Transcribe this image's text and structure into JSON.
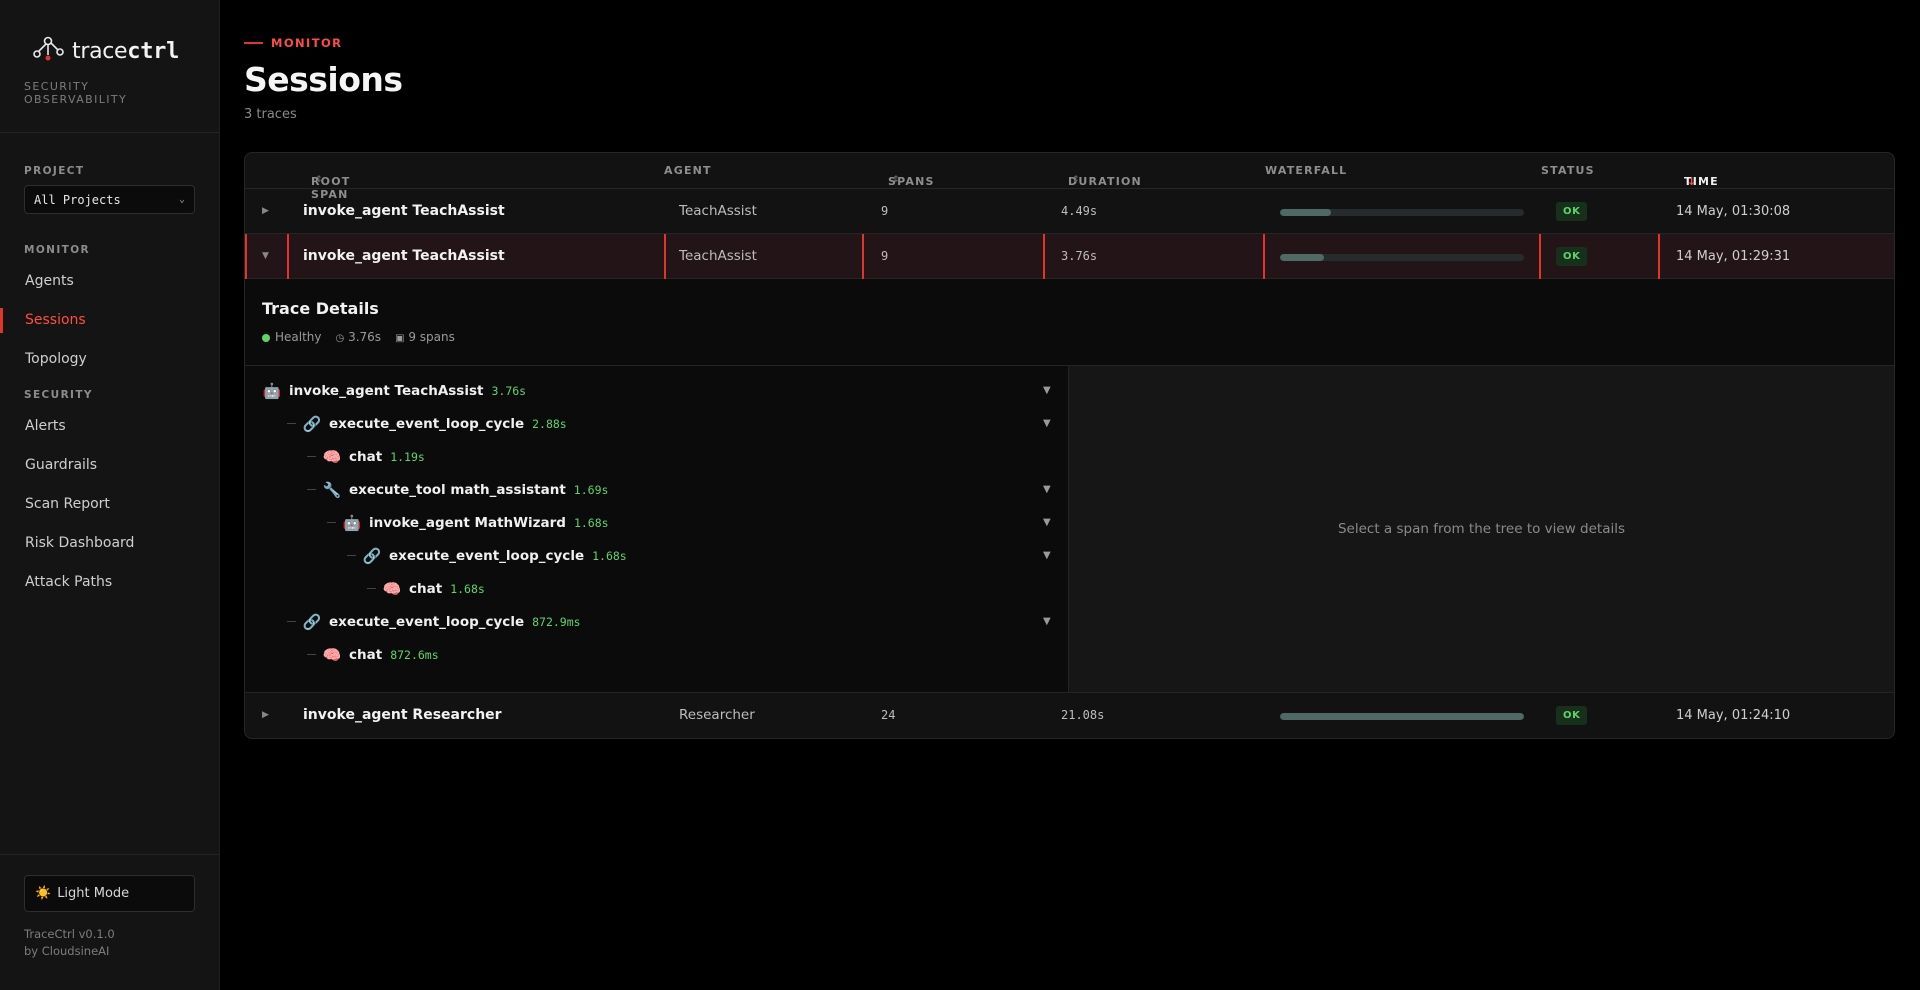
{
  "brand": {
    "logo_left": "trace",
    "logo_right": "ctrl",
    "subtitle": "SECURITY OBSERVABILITY"
  },
  "project": {
    "label": "PROJECT",
    "selected": "All Projects"
  },
  "nav": {
    "monitor_label": "MONITOR",
    "monitor_items": [
      "Agents",
      "Sessions",
      "Topology"
    ],
    "security_label": "SECURITY",
    "security_items": [
      "Alerts",
      "Guardrails",
      "Scan Report",
      "Risk Dashboard",
      "Attack Paths"
    ]
  },
  "footer": {
    "mode_icon": "☀️",
    "mode_label": "Light Mode",
    "version": "TraceCtrl v0.1.0",
    "by": "by CloudsineAI"
  },
  "header": {
    "eyebrow": "MONITOR",
    "title": "Sessions",
    "count": "3 traces"
  },
  "table": {
    "columns": {
      "root": "ROOT SPAN",
      "agent": "AGENT",
      "spans": "SPANS",
      "duration": "DURATION",
      "waterfall": "WATERFALL",
      "status": "STATUS",
      "time": "TIME"
    },
    "rows": [
      {
        "root": "invoke_agent TeachAssist",
        "agent": "TeachAssist",
        "spans": "9",
        "duration": "4.49s",
        "waterfall": 0.21,
        "status": "OK",
        "time": "14 May, 01:30:08"
      },
      {
        "root": "invoke_agent TeachAssist",
        "agent": "TeachAssist",
        "spans": "9",
        "duration": "3.76s",
        "waterfall": 0.18,
        "status": "OK",
        "time": "14 May, 01:29:31"
      },
      {
        "root": "invoke_agent Researcher",
        "agent": "Researcher",
        "spans": "24",
        "duration": "21.08s",
        "waterfall": 1.0,
        "status": "OK",
        "time": "14 May, 01:24:10"
      }
    ]
  },
  "details": {
    "title": "Trace Details",
    "health": "Healthy",
    "duration": "3.76s",
    "spans": "9 spans",
    "empty_message": "Select a span from the tree to view details",
    "tree": [
      {
        "icon": "🤖",
        "name": "invoke_agent TeachAssist",
        "duration": "3.76s"
      },
      {
        "icon": "🔗",
        "name": "execute_event_loop_cycle",
        "duration": "2.88s"
      },
      {
        "icon": "🧠",
        "name": "chat",
        "duration": "1.19s"
      },
      {
        "icon": "🔧",
        "name": "execute_tool math_assistant",
        "duration": "1.69s"
      },
      {
        "icon": "🤖",
        "name": "invoke_agent MathWizard",
        "duration": "1.68s"
      },
      {
        "icon": "🔗",
        "name": "execute_event_loop_cycle",
        "duration": "1.68s"
      },
      {
        "icon": "🧠",
        "name": "chat",
        "duration": "1.68s"
      },
      {
        "icon": "🔗",
        "name": "execute_event_loop_cycle",
        "duration": "872.9ms"
      },
      {
        "icon": "🧠",
        "name": "chat",
        "duration": "872.6ms"
      }
    ]
  },
  "colors": {
    "accent": "#e0352b",
    "ok": "#5ed46a",
    "waterfall": "#4f6965"
  }
}
